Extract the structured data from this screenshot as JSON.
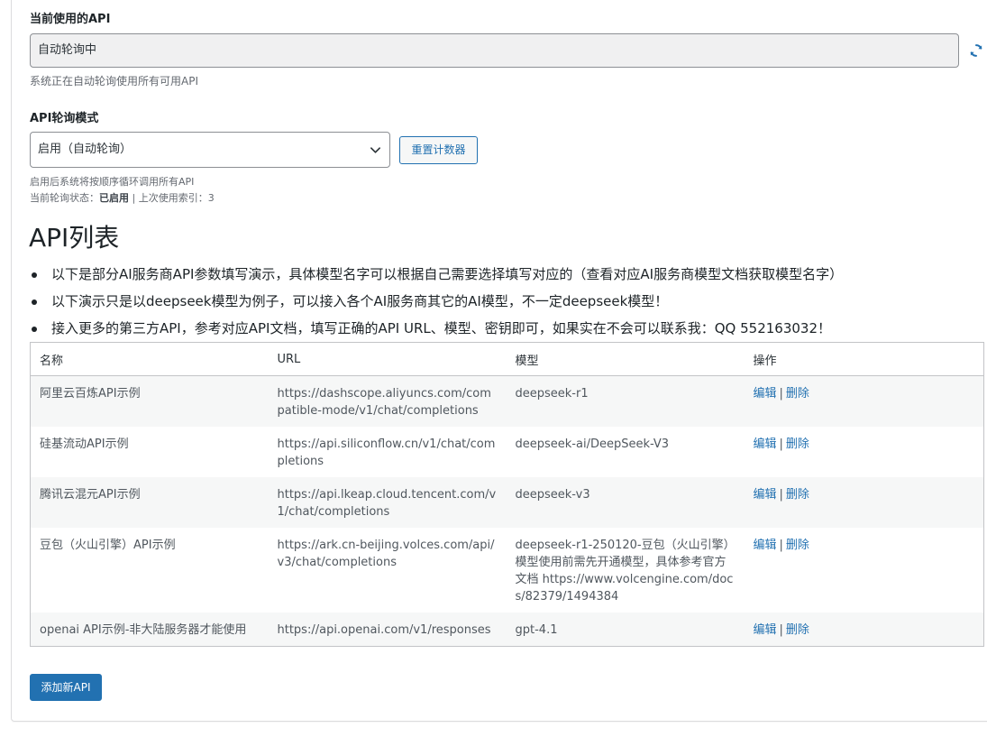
{
  "current_api": {
    "label": "当前使用的API",
    "value": "自动轮询中",
    "description": "系统正在自动轮询使用所有可用API",
    "refresh_icon": "refresh-icon"
  },
  "polling": {
    "label": "API轮询模式",
    "selected": "启用（自动轮询）",
    "reset_button": "重置计数器",
    "help": "启用后系统将按顺序循环调用所有API",
    "status_prefix": "当前轮询状态：",
    "status_value": "已启用",
    "status_suffix": " | 上次使用索引：3"
  },
  "api_list": {
    "title": "API列表",
    "notes": [
      "以下是部分AI服务商API参数填写演示，具体模型名字可以根据自己需要选择填写对应的（查看对应AI服务商模型文档获取模型名字）",
      "以下演示只是以deepseek模型为例子，可以接入各个AI服务商其它的AI模型，不一定deepseek模型！",
      "接入更多的第三方API，参考对应API文档，填写正确的API URL、模型、密钥即可，如果实在不会可以联系我：QQ 552163032！"
    ],
    "columns": [
      "名称",
      "URL",
      "模型",
      "操作"
    ],
    "rows": [
      {
        "name": "阿里云百炼API示例",
        "url": "https://dashscope.aliyuncs.com/compatible-mode/v1/chat/completions",
        "model": "deepseek-r1",
        "edit": "编辑",
        "delete": "删除"
      },
      {
        "name": "硅基流动API示例",
        "url": "https://api.siliconflow.cn/v1/chat/completions",
        "model": "deepseek-ai/DeepSeek-V3",
        "edit": "编辑",
        "delete": "删除"
      },
      {
        "name": "腾讯云混元API示例",
        "url": "https://api.lkeap.cloud.tencent.com/v1/chat/completions",
        "model": "deepseek-v3",
        "edit": "编辑",
        "delete": "删除"
      },
      {
        "name": "豆包（火山引擎）API示例",
        "url": "https://ark.cn-beijing.volces.com/api/v3/chat/completions",
        "model": "deepseek-r1-250120-豆包（火山引擎）模型使用前需先开通模型，具体参考官方文档 https://www.volcengine.com/docs/82379/1494384",
        "edit": "编辑",
        "delete": "删除"
      },
      {
        "name": "openai API示例-非大陆服务器才能使用",
        "url": "https://api.openai.com/v1/responses",
        "model": "gpt-4.1",
        "edit": "编辑",
        "delete": "删除"
      }
    ],
    "separator": "|",
    "add_button": "添加新API"
  },
  "colors": {
    "accent": "#2271b1",
    "readonly_bg": "#f0f0f1",
    "row_alt": "#f6f7f7"
  }
}
